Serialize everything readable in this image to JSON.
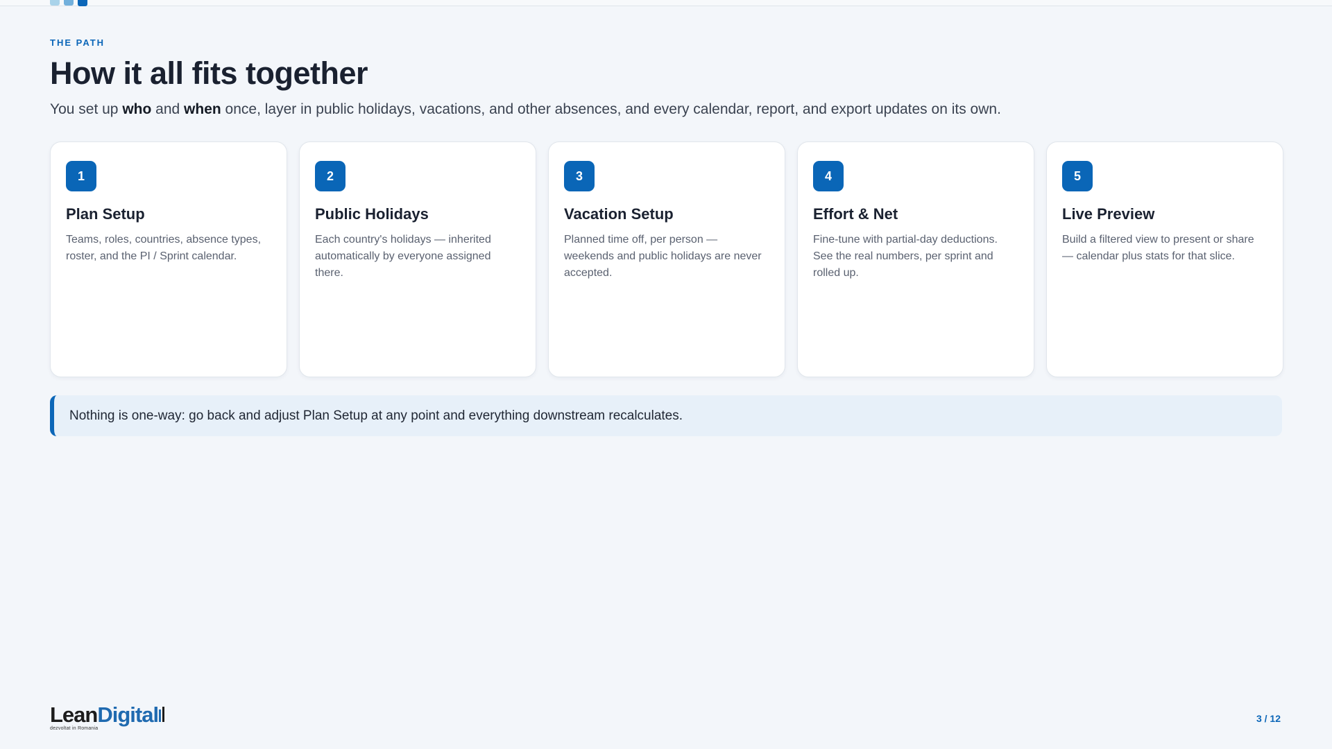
{
  "header": {
    "eyebrow": "THE PATH",
    "title": "How it all fits together",
    "subtitle_parts": {
      "a": "You set up ",
      "who": "who",
      "b": " and ",
      "when": "when",
      "c": " once, layer in public holidays, vacations, and other absences, and every calendar, report, and export updates on its own."
    }
  },
  "progress": {
    "current": 3,
    "total": 12
  },
  "steps": [
    {
      "number": "1",
      "title": "Plan Setup",
      "description": "Teams, roles, countries, absence types, roster, and the PI / Sprint calendar."
    },
    {
      "number": "2",
      "title": "Public Holidays",
      "description": "Each country's holidays — inherited automatically by everyone assigned there."
    },
    {
      "number": "3",
      "title": "Vacation Setup",
      "description": "Planned time off, per person — weekends and public holidays are never accepted."
    },
    {
      "number": "4",
      "title": "Effort & Net",
      "description": "Fine-tune with partial-day deductions. See the real numbers, per sprint and rolled up."
    },
    {
      "number": "5",
      "title": "Live Preview",
      "description": "Build a filtered view to present or share — calendar plus stats for that slice."
    }
  ],
  "note": "Nothing is one-way: go back and adjust Plan Setup at any point and everything downstream recalculates.",
  "footer": {
    "logo_lean": "Lean",
    "logo_digital": "Digital",
    "logo_tagline": "dezvoltat in Romania",
    "page": "3 / 12"
  },
  "colors": {
    "accent": "#0b66b8",
    "background": "#f3f6fa",
    "card": "#ffffff",
    "note_bg": "#e7f0f9"
  }
}
